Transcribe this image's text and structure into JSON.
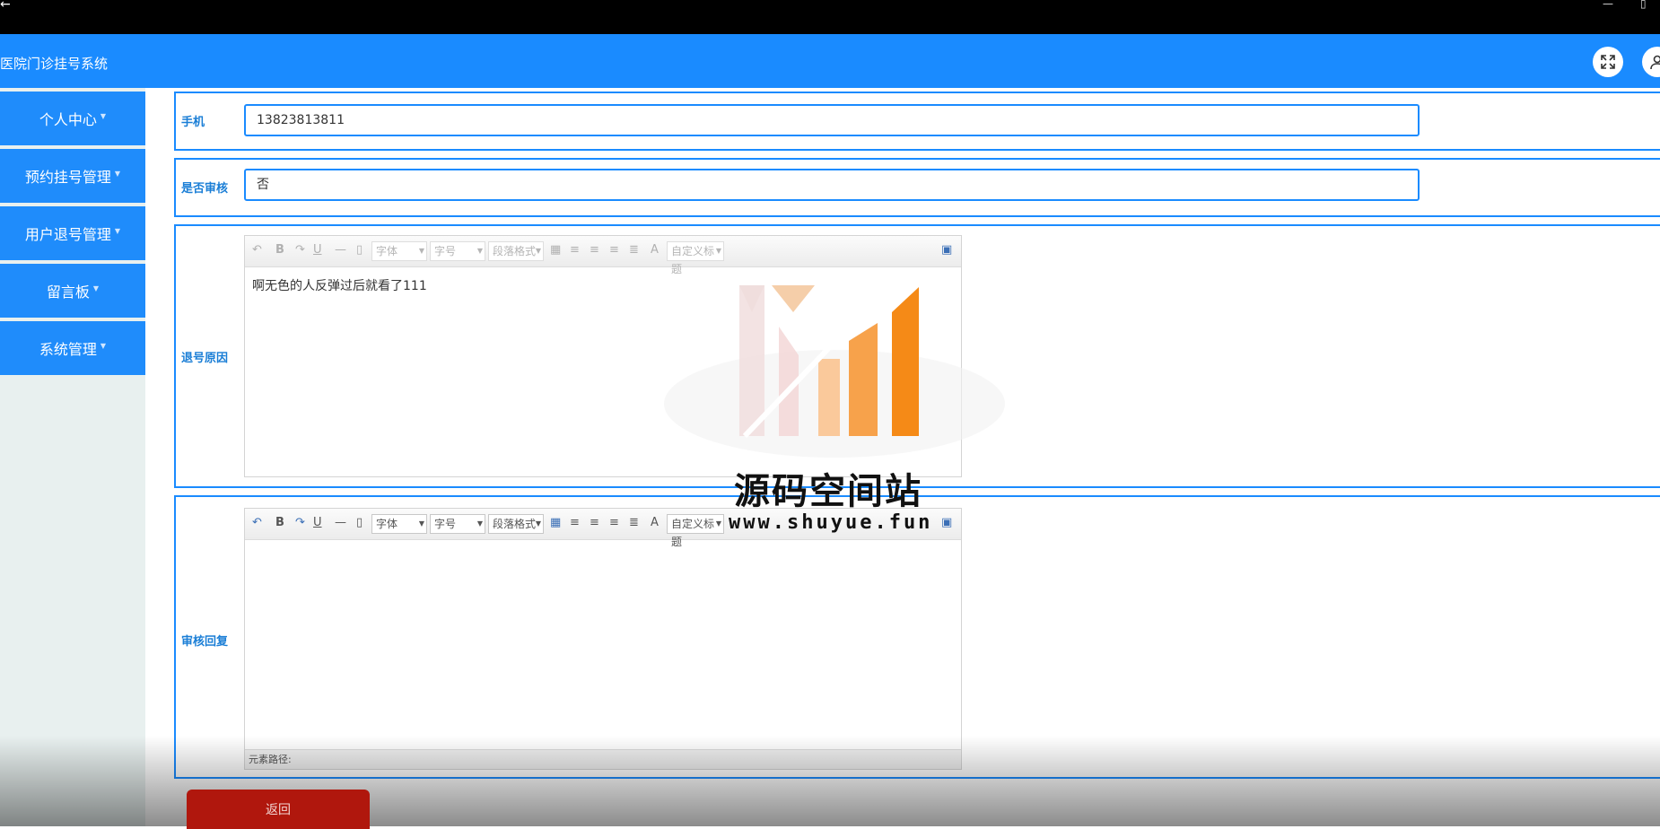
{
  "header": {
    "title": "医院门诊挂号系统"
  },
  "sidebar": {
    "items": [
      {
        "label": "个人中心"
      },
      {
        "label": "预约挂号管理"
      },
      {
        "label": "用户退号管理"
      },
      {
        "label": "留言板"
      },
      {
        "label": "系统管理"
      }
    ]
  },
  "form": {
    "phone": {
      "label": "手机",
      "value": "13823813811"
    },
    "audit": {
      "label": "是否审核",
      "value": "否"
    },
    "reason": {
      "label": "退号原因",
      "content": "啊无色的人反弹过后就看了111"
    },
    "reply": {
      "label": "审核回复",
      "content": ""
    }
  },
  "editor_toolbar": {
    "font": "字体",
    "size": "字号",
    "paragraph": "段落格式",
    "custom_title": "自定义标题",
    "bold": "B",
    "underline": "U",
    "font_color": "A"
  },
  "editor_status": {
    "path_label": "元素路径:"
  },
  "actions": {
    "back": "返回"
  },
  "watermark": {
    "name": "源码空间站",
    "url": "www.shuyue.fun"
  },
  "colors": {
    "primary": "#1a8bff",
    "back_button": "#b0170d"
  }
}
